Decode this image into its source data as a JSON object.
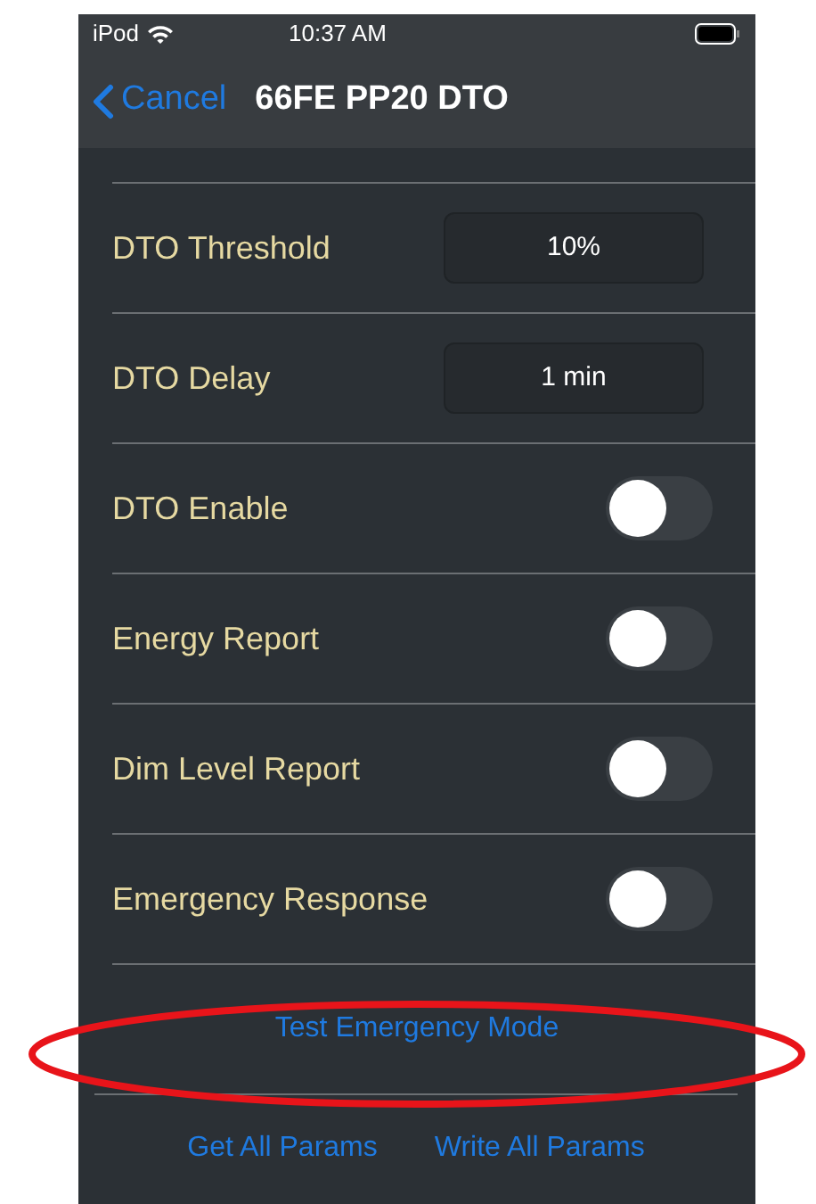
{
  "status_bar": {
    "carrier": "iPod",
    "time": "10:37 AM"
  },
  "nav": {
    "back": "Cancel",
    "title": "66FE PP20 DTO"
  },
  "rows": [
    {
      "kind": "field",
      "label": "DTO Threshold",
      "value": "10%"
    },
    {
      "kind": "field",
      "label": "DTO Delay",
      "value": "1 min"
    },
    {
      "kind": "toggle",
      "label": "DTO Enable",
      "on": false
    },
    {
      "kind": "toggle",
      "label": "Energy Report",
      "on": false
    },
    {
      "kind": "toggle",
      "label": "Dim Level Report",
      "on": false
    },
    {
      "kind": "toggle",
      "label": "Emergency Response",
      "on": false
    }
  ],
  "test_button": "Test Emergency Mode",
  "bottom_buttons": [
    "Get All Params",
    "Write All Params"
  ],
  "annotations": [
    {
      "kind": "ellipse"
    }
  ]
}
